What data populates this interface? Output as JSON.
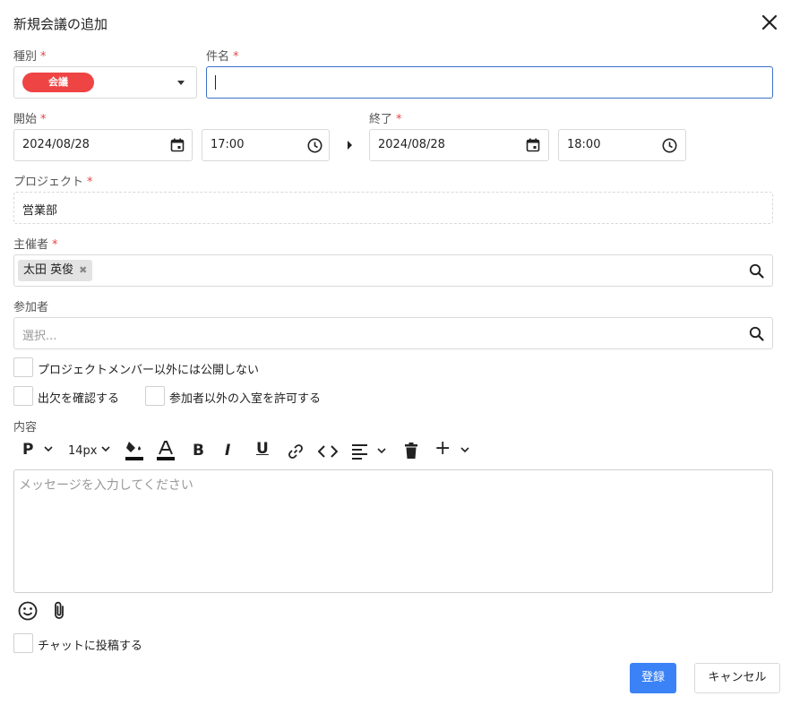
{
  "dialog": {
    "title": "新規会議の追加"
  },
  "type_field": {
    "label": "種別",
    "required": "*",
    "value": "会議",
    "color": "#ef4444"
  },
  "subject_field": {
    "label": "件名",
    "required": "*",
    "value": ""
  },
  "start": {
    "label": "開始",
    "required": "*",
    "date": "2024/08/28",
    "time": "17:00"
  },
  "end": {
    "label": "終了",
    "required": "*",
    "date": "2024/08/28",
    "time": "18:00"
  },
  "project": {
    "label": "プロジェクト",
    "required": "*",
    "value": "営業部"
  },
  "organizer": {
    "label": "主催者",
    "required": "*",
    "chip": "太田 英俊",
    "chip_remove": "✖"
  },
  "participants": {
    "label": "参加者",
    "placeholder": "選択..."
  },
  "options": {
    "private": "プロジェクトメンバー以外には公開しない",
    "attendance": "出欠を確認する",
    "allow_entry": "参加者以外の入室を許可する"
  },
  "content": {
    "label": "内容",
    "toolbar": {
      "paragraph": "P",
      "font_size": "14px",
      "bold": "B",
      "italic": "I",
      "underline": "U",
      "add": "+"
    },
    "placeholder": "メッセージを入力してください"
  },
  "post_to_chat": "チャットに投稿する",
  "buttons": {
    "register": "登録",
    "cancel": "キャンセル"
  },
  "colors": {
    "accent": "#3b82f6",
    "required": "#e54545",
    "focus_border": "#3b73c8",
    "type_pill": "#ef4444"
  },
  "icons": [
    "close-icon",
    "dropdown-caret-icon",
    "calendar-icon",
    "clock-icon",
    "arrow-right-icon",
    "search-icon",
    "chevron-down-icon",
    "text-color-icon",
    "fill-color-icon",
    "link-icon",
    "code-icon",
    "align-left-icon",
    "trash-icon",
    "emoji-icon",
    "paperclip-icon"
  ]
}
